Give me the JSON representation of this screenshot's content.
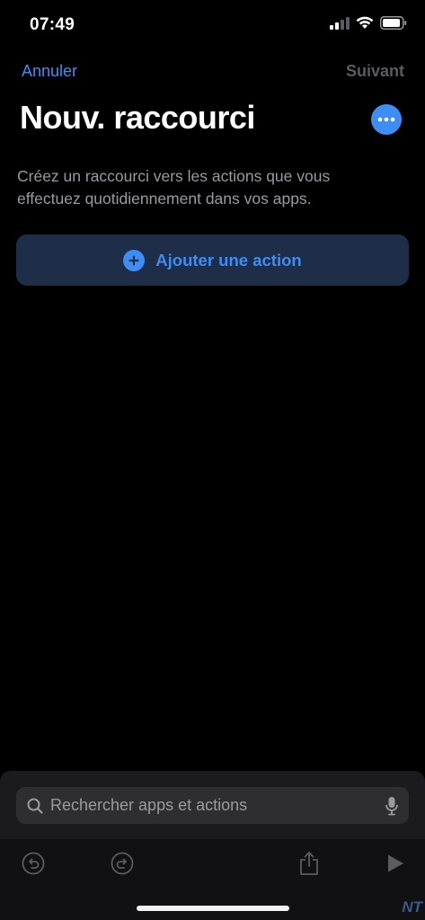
{
  "status_bar": {
    "time": "07:49",
    "icons": [
      "cellular-signal-icon",
      "wifi-icon",
      "battery-icon"
    ]
  },
  "nav": {
    "cancel_label": "Annuler",
    "next_label": "Suivant"
  },
  "header": {
    "title": "Nouv. raccourci",
    "more_icon": "ellipsis-icon"
  },
  "main": {
    "description": "Créez un raccourci vers les actions que vous effectuez quotidiennement dans vos apps.",
    "add_action_label": "Ajouter une action"
  },
  "search": {
    "placeholder": "Rechercher apps et actions"
  },
  "toolbar": {
    "icons": [
      "undo-icon",
      "redo-icon",
      "share-icon",
      "play-icon"
    ]
  },
  "watermark": "NT",
  "colors": {
    "accent": "#3d8df5",
    "background": "#000000",
    "disabled": "#5b5b60",
    "button_bg": "#1e2e48"
  }
}
